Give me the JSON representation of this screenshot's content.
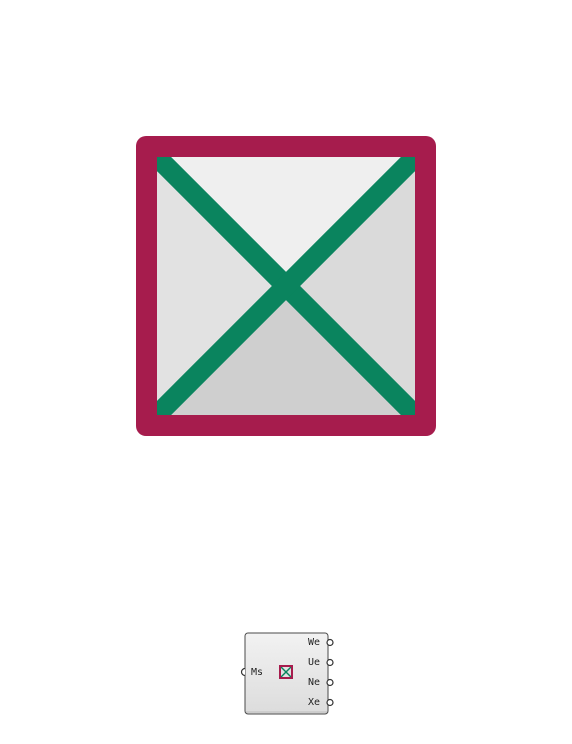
{
  "icon": {
    "name": "box-cross-icon",
    "colors": {
      "frame": "#a61c4d",
      "cross": "#0a845e",
      "fill_light": "#efefef",
      "fill_mid": "#e2e2e2",
      "fill_dark": "#cfcfcf"
    }
  },
  "component": {
    "icon_name": "box-cross-icon",
    "inputs": [
      {
        "label": "Ms"
      }
    ],
    "outputs": [
      {
        "label": "We"
      },
      {
        "label": "Ue"
      },
      {
        "label": "Ne"
      },
      {
        "label": "Xe"
      }
    ]
  }
}
